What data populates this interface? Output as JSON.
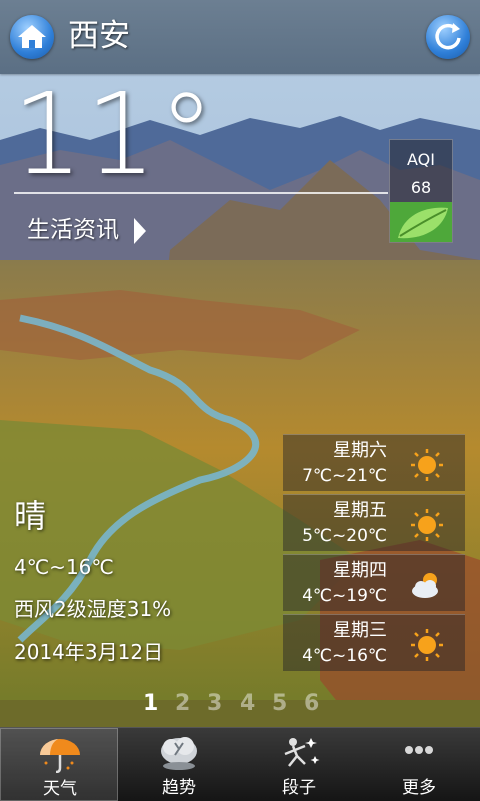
{
  "header": {
    "city": "西安"
  },
  "current": {
    "temperature": "11°",
    "life_info_label": "生活资讯",
    "condition": "晴",
    "temp_range": "4℃~16℃",
    "wind_humidity": "西风2级湿度31%",
    "date": "2014年3月12日"
  },
  "aqi": {
    "label": "AQI",
    "value": "68",
    "color": "#4ea83a"
  },
  "forecast": [
    {
      "day": "星期六",
      "temp": "7℃~21℃",
      "icon": "sun-icon"
    },
    {
      "day": "星期五",
      "temp": "5℃~20℃",
      "icon": "sun-icon"
    },
    {
      "day": "星期四",
      "temp": "4℃~19℃",
      "icon": "cloudy-sun-icon"
    },
    {
      "day": "星期三",
      "temp": "4℃~16℃",
      "icon": "sun-icon"
    }
  ],
  "pager": {
    "pages": [
      "1",
      "2",
      "3",
      "4",
      "5",
      "6"
    ],
    "current": "1"
  },
  "nav": [
    {
      "label": "天气",
      "icon": "umbrella-icon",
      "active": true
    },
    {
      "label": "趋势",
      "icon": "trend-icon",
      "active": false
    },
    {
      "label": "段子",
      "icon": "joke-icon",
      "active": false
    },
    {
      "label": "更多",
      "icon": "more-icon",
      "active": false
    }
  ]
}
